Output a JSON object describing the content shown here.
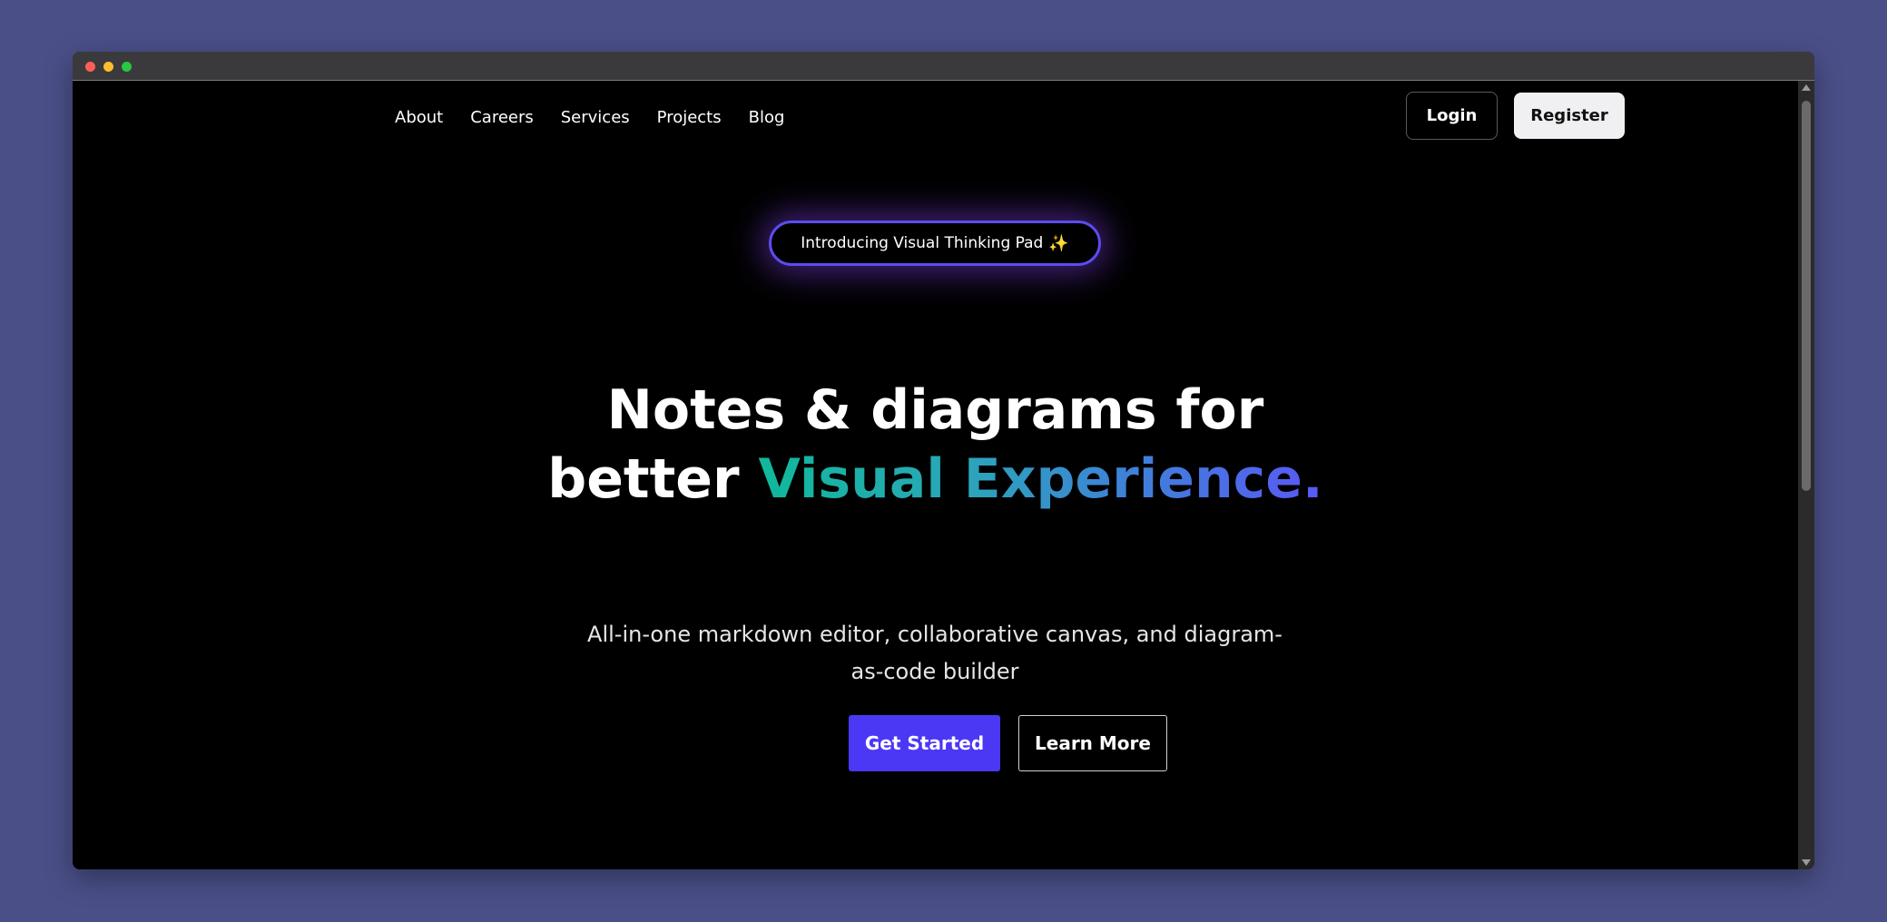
{
  "nav": {
    "links": [
      {
        "label": "About"
      },
      {
        "label": "Careers"
      },
      {
        "label": "Services"
      },
      {
        "label": "Projects"
      },
      {
        "label": "Blog"
      }
    ],
    "login_label": "Login",
    "register_label": "Register"
  },
  "badge": {
    "text": "Introducing Visual Thinking Pad",
    "emoji": "✨"
  },
  "hero": {
    "line1": "Notes & diagrams for",
    "line2_plain": "better ",
    "line2_highlight": "Visual Experience.",
    "subtitle": "All-in-one markdown editor, collaborative canvas, and diagram-as-code builder",
    "primary_cta": "Get Started",
    "secondary_cta": "Learn More"
  },
  "colors": {
    "page_background": "#4a4f88",
    "content_background": "#000000",
    "accent": "#4b38f5",
    "gradient_start": "#10b89a",
    "gradient_end": "#5a58f5"
  }
}
